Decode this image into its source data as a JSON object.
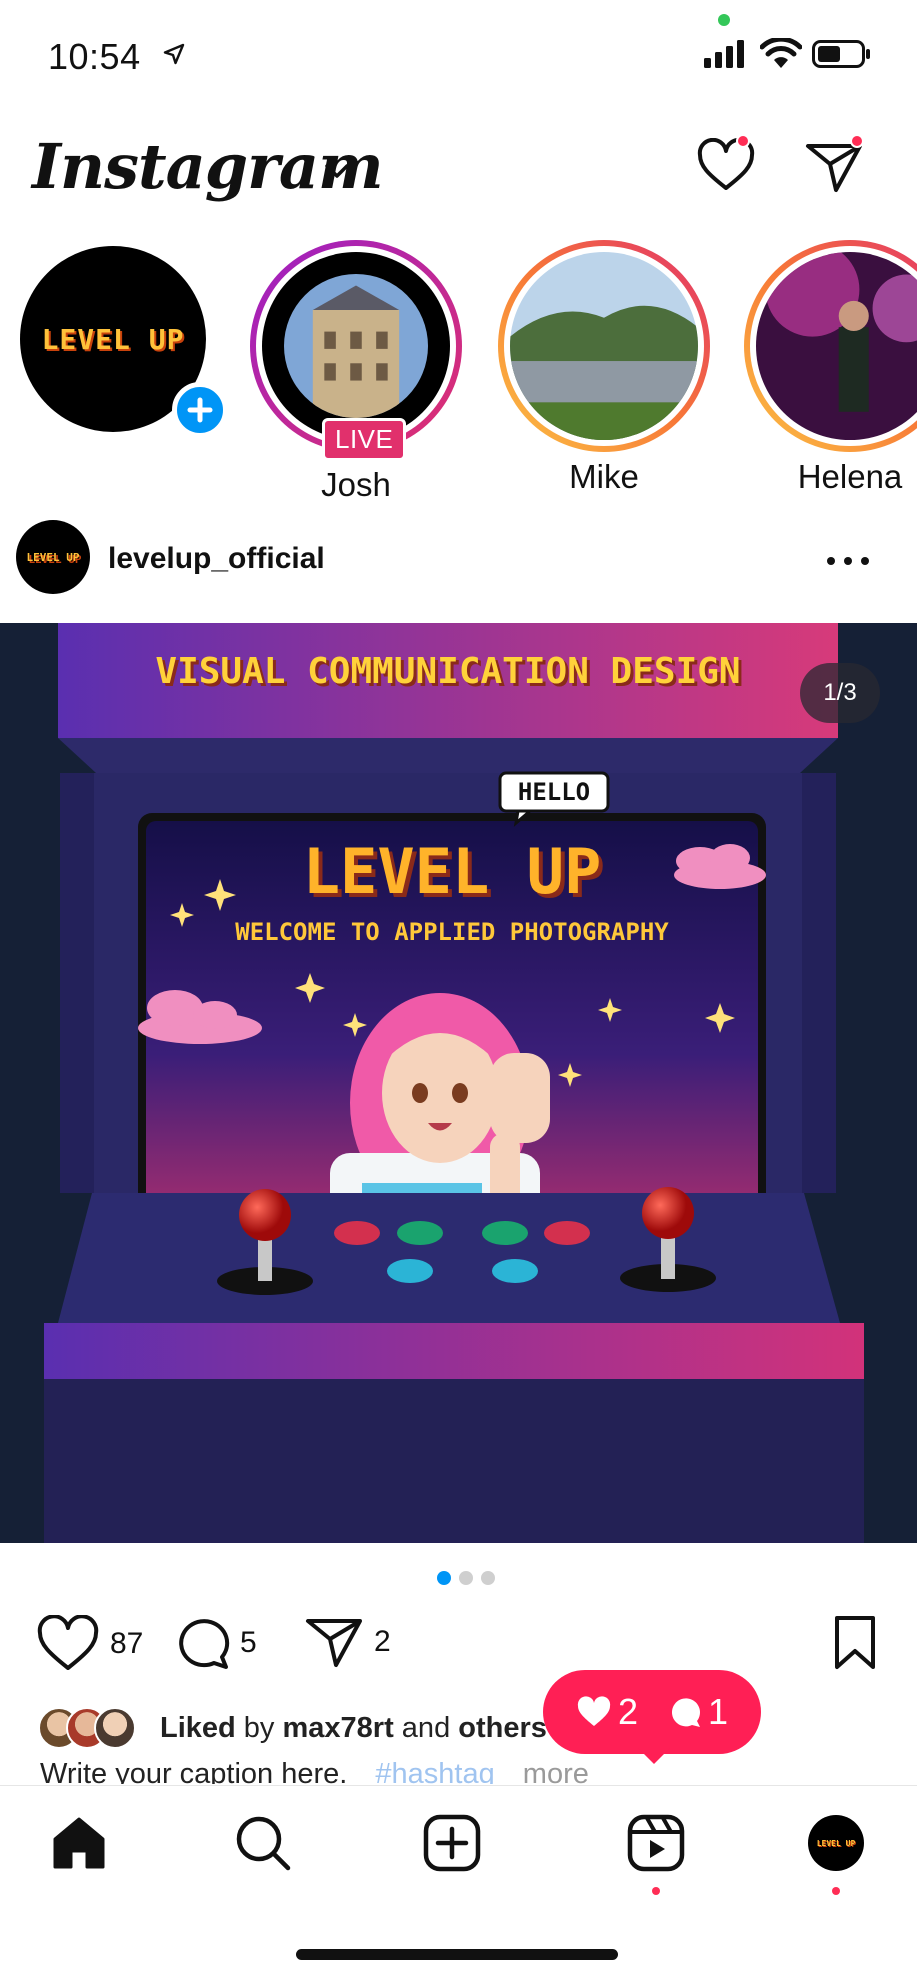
{
  "status_bar": {
    "time": "10:54"
  },
  "header": {
    "logo_text": "Instagram",
    "icons": [
      "heart-icon",
      "direct-message-icon",
      "chevron-down-icon"
    ]
  },
  "stories": [
    {
      "name": "",
      "kind": "own",
      "logo_text": "LEVEL UP"
    },
    {
      "name": "Josh",
      "kind": "live",
      "badge": "LIVE"
    },
    {
      "name": "Mike",
      "kind": "story"
    },
    {
      "name": "Helena",
      "kind": "story"
    }
  ],
  "post": {
    "username": "levelup_official",
    "avatar_text": "LEVEL UP",
    "carousel_counter": "1/3",
    "image": {
      "banner": "VISUAL COMMUNICATION DESIGN",
      "title": "LEVEL UP",
      "subtitle": "WELCOME TO APPLIED PHOTOGRAPHY",
      "speech": "HELLO"
    },
    "carousel_position": 1,
    "carousel_total": 3,
    "likes_count": "87",
    "comments_count": "5",
    "shares_count": "2",
    "liked_by": {
      "prefix": "Liked",
      "by": " by ",
      "user": "max78rt",
      "and": " and ",
      "others": "others"
    },
    "caption": {
      "text": "Write your caption here.",
      "hashtag": "#hashtag",
      "more": "more"
    }
  },
  "activity": {
    "likes": "2",
    "comments": "1"
  },
  "bottom_nav": {
    "avatar_text": "LEVEL UP",
    "items": [
      "home-icon",
      "search-icon",
      "create-icon",
      "reels-icon",
      "profile-avatar"
    ]
  },
  "colors": {
    "accent_blue": "#0095f6",
    "notification_red": "#ff2d55",
    "activity_pink": "#ff1f55",
    "live_pink": "#e1306c"
  }
}
